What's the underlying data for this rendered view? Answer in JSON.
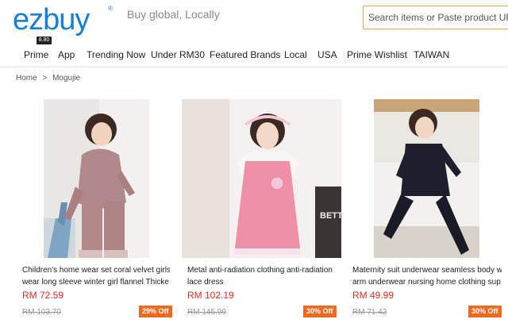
{
  "brand": {
    "logo_text": "ezbuy",
    "registered_mark": "®",
    "tagline": "Buy global, Locally"
  },
  "search": {
    "placeholder": "Search items or Paste product URL"
  },
  "nav": {
    "badge": "8.80",
    "items": [
      "Prime",
      "App",
      "Trending Now",
      "Under RM30",
      "Featured Brands",
      "Local",
      "USA",
      "Prime Wishlist",
      "TAIWAN"
    ]
  },
  "breadcrumb": {
    "home": "Home",
    "separator": ">",
    "current": "Mogujie"
  },
  "products": [
    {
      "title_line1": "Children's home wear set coral velvet girls '",
      "title_line2": "wear long sleeve winter girl flannel Thicke",
      "price": "RM 72.59",
      "old_price": "RM 103.70",
      "discount": "29% Off"
    },
    {
      "title_line1": "Metal anti-radiation clothing anti-radiation",
      "title_line2": "lace dress",
      "price": "RM 102.19",
      "old_price": "RM 145.99",
      "discount": "30% Off",
      "image_sign_text": "BETTE"
    },
    {
      "title_line1": "Maternity suit underwear seamless body w",
      "title_line2": "arm underwear nursing home clothing sup",
      "price": "RM 49.99",
      "old_price": "RM 71.42",
      "discount": "30% Off"
    }
  ],
  "colors": {
    "brand_blue": "#1a7fd4",
    "price_red": "#e22b20",
    "discount_orange": "#ef6a1e",
    "search_border": "#f0a04a"
  }
}
